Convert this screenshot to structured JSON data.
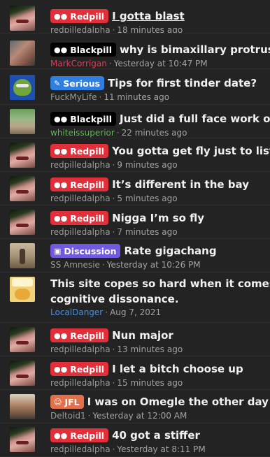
{
  "threads": [
    {
      "prefix": "Redpill",
      "title": "I gotta blast",
      "author": "redpilledalpha",
      "time": "18 minutes ago"
    },
    {
      "prefix": "Blackpill",
      "title": "why is bimaxillary protrusion s",
      "author": "MarkCorrigan",
      "time": "Yesterday at 10:47 PM"
    },
    {
      "prefix": "Serious",
      "title": "Tips for first tinder date?",
      "author": "FuckMyLife",
      "time": "11 minutes ago"
    },
    {
      "prefix": "Blackpill",
      "title": "Just did a full face work out [T",
      "author": "whiteissuperior",
      "time": "22 minutes ago"
    },
    {
      "prefix": "Redpill",
      "title": "You gotta get fly just to listen to",
      "author": "redpilledalpha",
      "time": "9 minutes ago"
    },
    {
      "prefix": "Redpill",
      "title": "It’s different in the bay",
      "author": "redpilledalpha",
      "time": "5 minutes ago"
    },
    {
      "prefix": "Redpill",
      "title": "Nigga I’m so fly",
      "author": "redpilledalpha",
      "time": "7 minutes ago"
    },
    {
      "prefix": "Discussion",
      "title": "Rate gigachang",
      "author": "SS Amnesie",
      "time": "Yesterday at 10:26 PM"
    },
    {
      "prefix": "",
      "title_line1": "This site copes so hard when it comes to T",
      "title_line2": "cognitive dissonance.",
      "author": "LocalDanger",
      "time": "Aug 7, 2021"
    },
    {
      "prefix": "Redpill",
      "title": "Nun major",
      "author": "redpilledalpha",
      "time": "13 minutes ago"
    },
    {
      "prefix": "Redpill",
      "title": "I let a bitch choose up",
      "author": "redpilledalpha",
      "time": "15 minutes ago"
    },
    {
      "prefix": "JFL",
      "title": "I was on Omegle the other day",
      "author": "Deltoid1",
      "time": "Yesterday at 12:00 AM"
    },
    {
      "prefix": "Redpill",
      "title": "40 got a stiffer",
      "author": "redpilledalpha",
      "time": "Yesterday at 8:11 PM"
    }
  ],
  "meta_separator": "·",
  "icons": {
    "redpill": "pills-icon",
    "blackpill": "pills-icon",
    "serious": "megaphone-icon",
    "discussion": "chat-bubbles-icon",
    "jfl": "laugh-emoji-icon"
  },
  "colors": {
    "background": "#232323",
    "redpill": "#e1303a",
    "blackpill": "#000000",
    "serious": "#2f7fe0",
    "discussion": "#7259e0",
    "jfl": "#e2704c",
    "author_red": "#d0445f",
    "author_green": "#5fb950",
    "author_blue": "#4a8fe0"
  }
}
